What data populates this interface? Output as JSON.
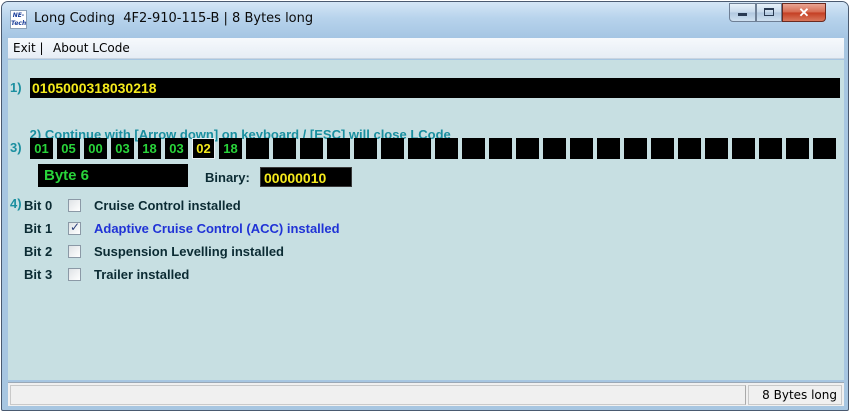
{
  "window": {
    "title": "Long Coding  4F2-910-115-B | 8 Bytes long",
    "logo_text": "NE-Tech"
  },
  "menu": {
    "items": [
      "Exit |",
      "About LCode"
    ]
  },
  "steps": {
    "code_label": "1)",
    "code_value": "0105000318030218",
    "instruction_label": "2)",
    "instruction_text": "Continue with [Arrow down] on keyboard / [ESC] will close LCode",
    "bytes_label": "3)",
    "bits_label": "4)"
  },
  "bytes": [
    "01",
    "05",
    "00",
    "03",
    "18",
    "03",
    "02",
    "18",
    "",
    "",
    "",
    "",
    "",
    "",
    "",
    "",
    "",
    "",
    "",
    "",
    "",
    "",
    "",
    "",
    "",
    "",
    "",
    "",
    "",
    ""
  ],
  "selected_byte_index": 6,
  "byte_detail": {
    "label": "Byte 6",
    "binary_caption": "Binary:",
    "binary_value": "00000010"
  },
  "bits": [
    {
      "name": "Bit 0",
      "desc": "Cruise Control installed",
      "checked": false
    },
    {
      "name": "Bit 1",
      "desc": "Adaptive Cruise Control (ACC) installed",
      "checked": true
    },
    {
      "name": "Bit 2",
      "desc": "Suspension Levelling installed",
      "checked": false
    },
    {
      "name": "Bit 3",
      "desc": "Trailer installed",
      "checked": false
    }
  ],
  "status": {
    "left": "",
    "right": "8 Bytes long"
  },
  "colors": {
    "code_text": "#f5ea1c",
    "byte_text": "#29d43a",
    "instruction_text": "#1a8fa0",
    "active_bit_text": "#2033d6"
  }
}
